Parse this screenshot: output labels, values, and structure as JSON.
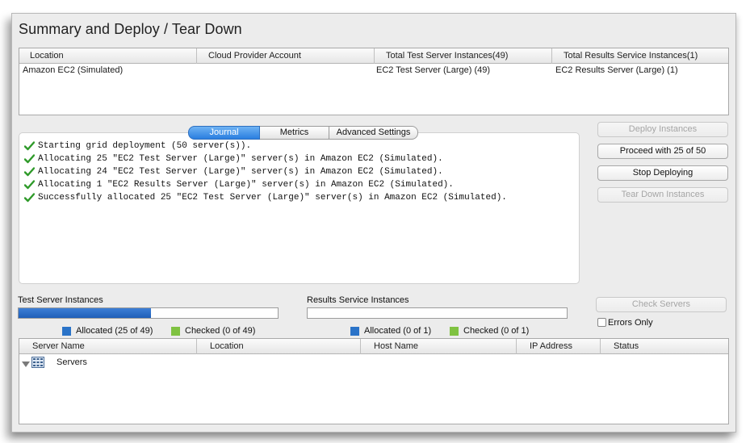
{
  "title": "Summary and Deploy / Tear Down",
  "summary_table": {
    "columns": [
      "Location",
      "Cloud Provider Account",
      "Total Test Server Instances(49)",
      "Total Results Service Instances(1)"
    ],
    "rows": [
      [
        "Amazon EC2 (Simulated)",
        "",
        "EC2 Test Server (Large) (49)",
        "EC2 Results Server (Large) (1)"
      ]
    ]
  },
  "tabs": [
    "Journal",
    "Metrics",
    "Advanced Settings"
  ],
  "active_tab": "Journal",
  "journal": [
    "Starting grid deployment (50 server(s)).",
    "Allocating 25 \"EC2 Test Server (Large)\" server(s) in Amazon EC2 (Simulated).",
    "Allocating 24 \"EC2 Test Server (Large)\" server(s) in Amazon EC2 (Simulated).",
    "Allocating 1 \"EC2 Results Server (Large)\" server(s) in Amazon EC2 (Simulated).",
    "Successfully allocated 25 \"EC2 Test Server (Large)\" server(s) in Amazon EC2 (Simulated)."
  ],
  "actions": {
    "deploy": "Deploy Instances",
    "proceed": "Proceed with 25 of 50",
    "stop": "Stop Deploying",
    "teardown": "Tear Down Instances",
    "check_servers": "Check Servers",
    "errors_only": "Errors Only"
  },
  "test_servers": {
    "label": "Test Server Instances",
    "allocated_fraction": 0.51,
    "allocated_label": "Allocated (25 of 49)",
    "checked_label": "Checked (0 of 49)"
  },
  "results_service": {
    "label": "Results Service Instances",
    "allocated_fraction": 0,
    "allocated_label": "Allocated (0 of 1)",
    "checked_label": "Checked (0 of 1)"
  },
  "colors": {
    "allocated": "#2a73c8",
    "checked": "#7fc241",
    "check_mark": "#2f9a2a"
  },
  "server_table": {
    "columns": [
      "Server Name",
      "Location",
      "Host Name",
      "IP Address",
      "Status"
    ],
    "tree_root": "Servers"
  }
}
